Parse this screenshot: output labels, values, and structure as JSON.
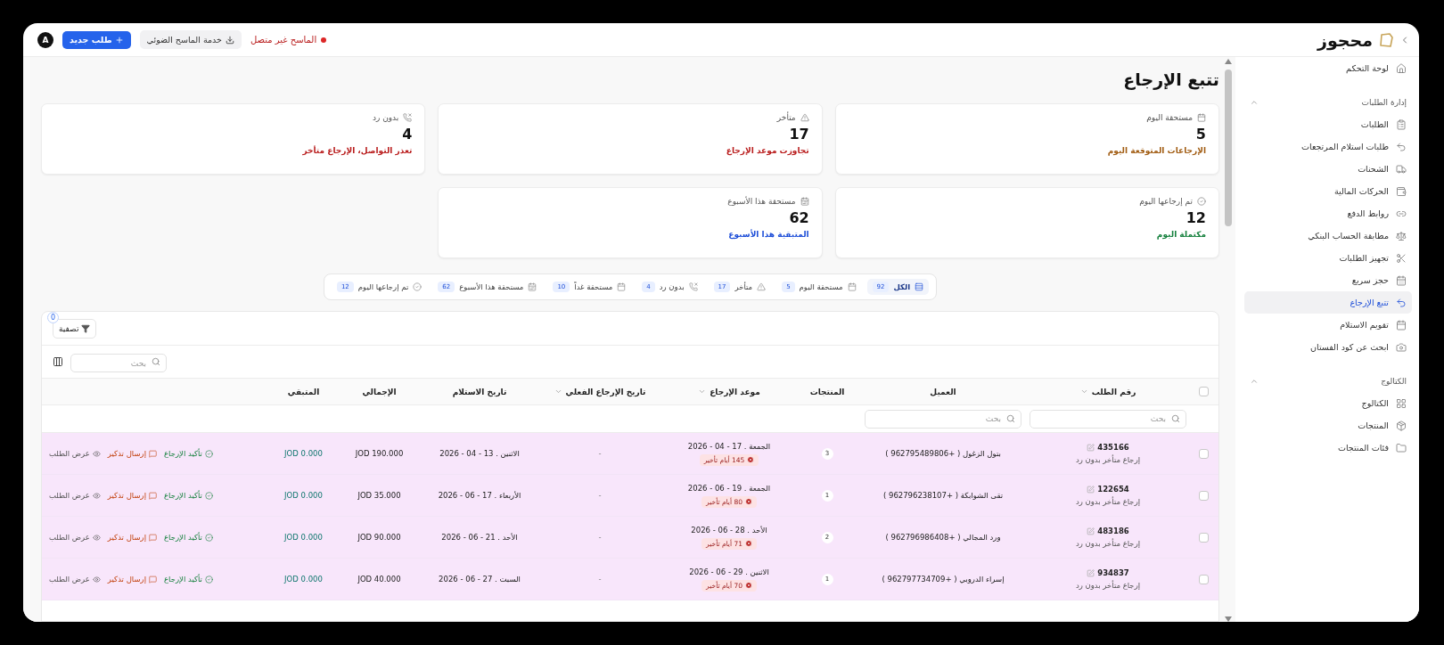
{
  "topbar": {
    "logo": "محجوز",
    "avatar": "A",
    "new_order_button": "طلب جديد",
    "scanner_button": "خدمة الماسح الضوئي",
    "scanner_status": {
      "text": "الماسح غير متصل",
      "connected": false
    }
  },
  "sidebar": {
    "top_item": {
      "label": "لوحة التحكم",
      "selected": false
    },
    "sections": [
      {
        "title": "إدارة الطلبات",
        "expanded": true,
        "items": [
          {
            "label": "الطلبات",
            "selected": false
          },
          {
            "label": "طلبات استلام المرتجعات",
            "selected": false
          },
          {
            "label": "الشحنات",
            "selected": false
          },
          {
            "label": "الحركات المالية",
            "selected": false
          },
          {
            "label": "روابط الدفع",
            "selected": false
          },
          {
            "label": "مطابقة الحساب البنكي",
            "selected": false
          },
          {
            "label": "تجهيز الطلبات",
            "selected": false
          },
          {
            "label": "حجز سريع",
            "selected": false
          },
          {
            "label": "تتبع الإرجاع",
            "selected": true
          },
          {
            "label": "تقويم الاستلام",
            "selected": false
          },
          {
            "label": "ابحث عن كود الفستان",
            "selected": false
          }
        ]
      },
      {
        "title": "الكتالوج",
        "expanded": true,
        "items": [
          {
            "label": "الكتالوج",
            "selected": false
          },
          {
            "label": "المنتجات",
            "selected": false
          },
          {
            "label": "فئات المنتجات",
            "selected": false
          }
        ]
      }
    ]
  },
  "page_title": "تتبع الإرجاع",
  "stat_cards": [
    {
      "label": "مستحقة اليوم",
      "value": "5",
      "note": "الإرجاعات المتوقعة اليوم",
      "color": "#a15c12"
    },
    {
      "label": "متأخر",
      "value": "17",
      "note": "تجاوزت موعد الإرجاع",
      "color": "#b91c1c"
    },
    {
      "label": "بدون رد",
      "value": "4",
      "note": "تعذر التواصل، الإرجاع متأخر",
      "color": "#b91c1c"
    },
    {
      "label": "تم إرجاعها اليوم",
      "value": "12",
      "note": "مكتملة اليوم",
      "color": "#15803d"
    },
    {
      "label": "مستحقة هذا الأسبوع",
      "value": "62",
      "note": "المتبقية هذا الأسبوع",
      "color": "#1d4ed8"
    }
  ],
  "filter_chips": [
    {
      "label": "الكل",
      "count": "92",
      "selected": true
    },
    {
      "label": "مستحقة اليوم",
      "count": "5",
      "selected": false
    },
    {
      "label": "متأخر",
      "count": "17",
      "selected": false
    },
    {
      "label": "بدون رد",
      "count": "4",
      "selected": false
    },
    {
      "label": "مستحقة غداً",
      "count": "10",
      "selected": false
    },
    {
      "label": "مستحقة هذا الأسبوع",
      "count": "62",
      "selected": false
    },
    {
      "label": "تم إرجاعها اليوم",
      "count": "12",
      "selected": false
    }
  ],
  "table": {
    "filter_button": {
      "label": "تصفية",
      "badge": "0"
    },
    "search_placeholder": "بحث",
    "select_all_checked": false,
    "columns": [
      {
        "label": "رقم الطلب",
        "sortable": true
      },
      {
        "label": "العميل",
        "sortable": false
      },
      {
        "label": "المنتجات",
        "sortable": false
      },
      {
        "label": "موعد الإرجاع",
        "sortable": true
      },
      {
        "label": "تاريخ الإرجاع الفعلي",
        "sortable": true
      },
      {
        "label": "تاريخ الاستلام",
        "sortable": false
      },
      {
        "label": "الإجمالي",
        "sortable": false
      },
      {
        "label": "المتبقي",
        "sortable": false
      }
    ],
    "column_filters": [
      {
        "placeholder": "بحث"
      },
      {
        "placeholder": "بحث"
      }
    ],
    "rows": [
      {
        "checked": false,
        "highlighted": true,
        "order_number": "435166",
        "order_status": "إرجاع متأخر بدون رد",
        "customer": "بتول الزغول ( +962795489806 )",
        "products": "3",
        "return_date": "الجمعة . 17 - 04 - 2026",
        "delay": "145 أيام تأخير",
        "actual_return": "-",
        "received_date": "الاثنين . 13 - 04 - 2026",
        "total": "JOD 190.000",
        "remaining": "JOD 0.000",
        "actions": [
          "تأكيد الإرجاع",
          "إرسال تذكير",
          "عرض الطلب"
        ]
      },
      {
        "checked": false,
        "highlighted": true,
        "order_number": "122654",
        "order_status": "إرجاع متأخر بدون رد",
        "customer": "تقى الشوابكة ( +962796238107 )",
        "products": "1",
        "return_date": "الجمعة . 19 - 06 - 2026",
        "delay": "80 أيام تأخير",
        "actual_return": "-",
        "received_date": "الأربعاء . 17 - 06 - 2026",
        "total": "JOD 35.000",
        "remaining": "JOD 0.000",
        "actions": [
          "تأكيد الإرجاع",
          "إرسال تذكير",
          "عرض الطلب"
        ]
      },
      {
        "checked": false,
        "highlighted": true,
        "order_number": "483186",
        "order_status": "إرجاع متأخر بدون رد",
        "customer": "ورد المجالي ( +962796986408 )",
        "products": "2",
        "return_date": "الأحد . 28 - 06 - 2026",
        "delay": "71 أيام تأخير",
        "actual_return": "-",
        "received_date": "الأحد . 21 - 06 - 2026",
        "total": "JOD 90.000",
        "remaining": "JOD 0.000",
        "actions": [
          "تأكيد الإرجاع",
          "إرسال تذكير",
          "عرض الطلب"
        ]
      },
      {
        "checked": false,
        "highlighted": true,
        "order_number": "934837",
        "order_status": "إرجاع متأخر بدون رد",
        "customer": "إسراء الدروبي ( +962797734709 )",
        "products": "1",
        "return_date": "الاثنين . 29 - 06 - 2026",
        "delay": "70 أيام تأخير",
        "actual_return": "-",
        "received_date": "السبت . 27 - 06 - 2026",
        "total": "JOD 40.000",
        "remaining": "JOD 0.000",
        "actions": [
          "تأكيد الإرجاع",
          "إرسال تذكير",
          "عرض الطلب"
        ]
      }
    ]
  }
}
